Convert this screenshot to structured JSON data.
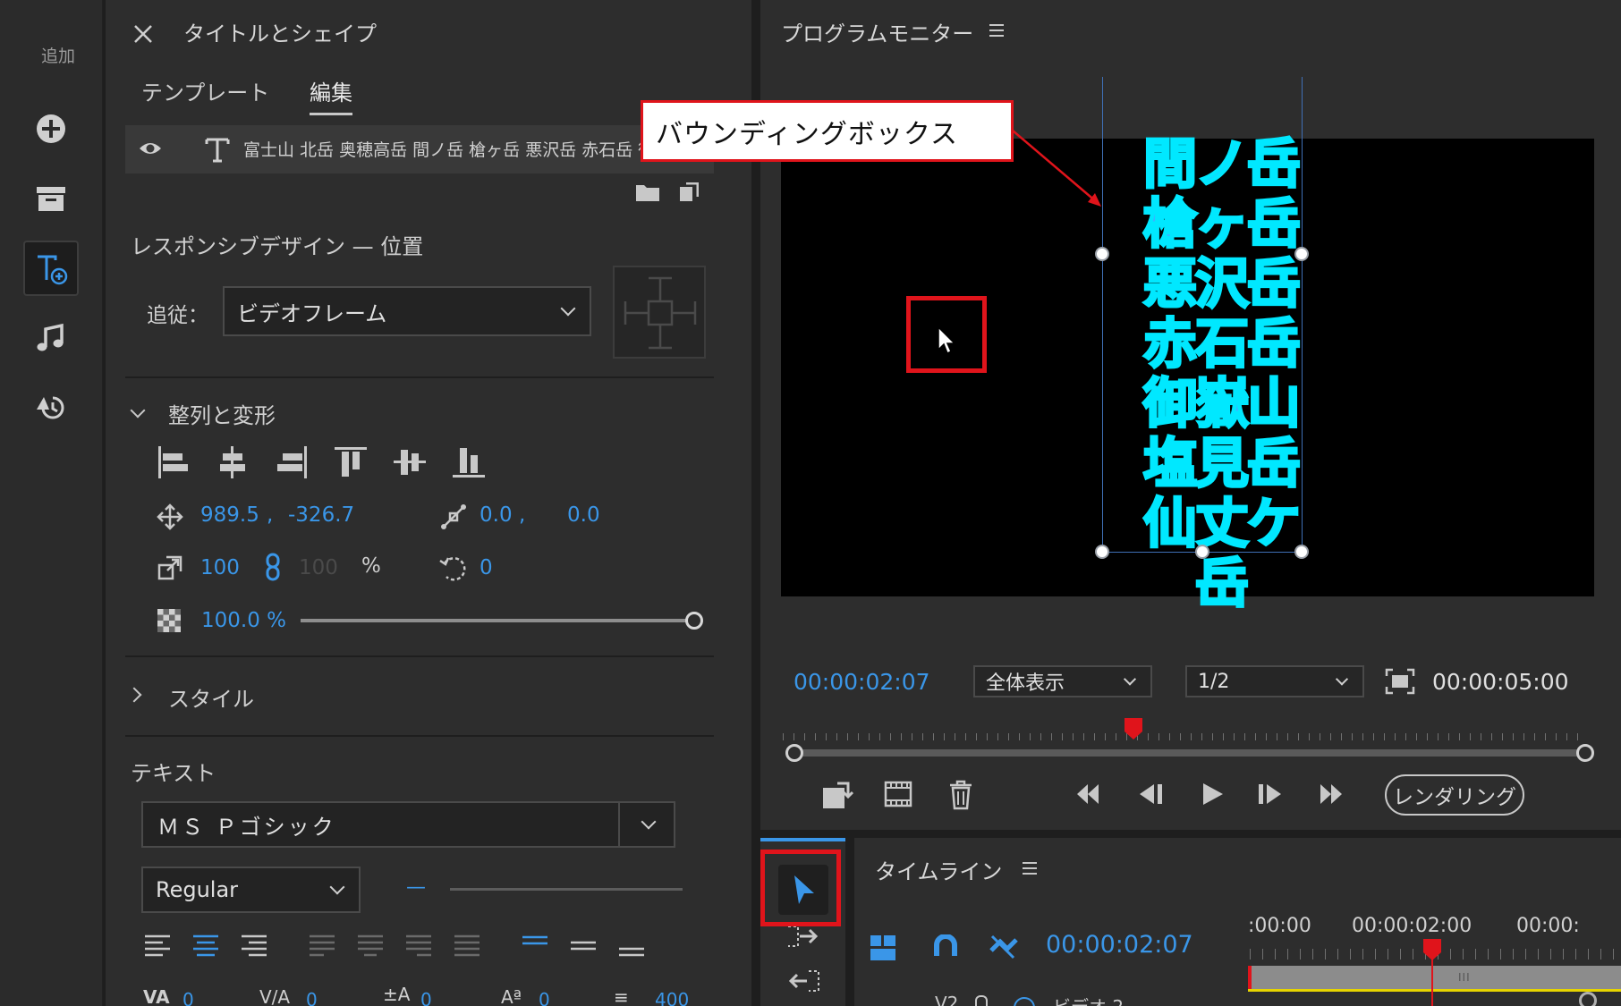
{
  "toolbar": {
    "add_label": "追加"
  },
  "essential_graphics": {
    "title": "タイトルとシェイプ",
    "tabs": [
      "テンプレート",
      "編集"
    ],
    "layer": {
      "name": "富士山 北岳 奥穂高岳 間ノ岳 槍ヶ岳 悪沢岳 赤石岳 御嶽"
    },
    "responsive": {
      "title": "レスポンシブデザイン — 位置",
      "follow_label": "追従：",
      "follow_value": "ビデオフレーム"
    },
    "align": {
      "title": "整列と変形",
      "position_x": "989.5",
      "position_y": "-326.7",
      "anchor_x": "0.0",
      "anchor_y": "0.0",
      "scale": "100",
      "scale_locked": "100",
      "scale_unit": "%",
      "rotation": "0",
      "opacity": "100.0 %",
      "opacity_level": 1.0
    },
    "style": {
      "title": "スタイル"
    },
    "text": {
      "title": "テキスト",
      "font": "ＭＳ Ｐゴシック",
      "font_style": "Regular",
      "size_placeholder": "—",
      "kerning": "0",
      "tracking": "0",
      "baseline": "0",
      "tsume": "0",
      "leading": "400"
    }
  },
  "program_monitor": {
    "title": "プログラムモニター",
    "text_lines": [
      "間ノ岳",
      "槍ヶ岳",
      "悪沢岳",
      "赤石岳",
      "御嶽山",
      "塩見岳",
      "仙丈ケ岳"
    ],
    "timecode": "00:00:02:07",
    "zoom": "全体表示",
    "resolution": "1/2",
    "duration": "00:00:05:00",
    "render_button": "レンダリング",
    "playhead_fraction": 0.44
  },
  "timeline": {
    "title": "タイムライン",
    "timecode": "00:00:02:07",
    "ruler_labels": [
      ":00:00",
      "00:00:02:00",
      "00:00:"
    ],
    "track_label": "V2",
    "track_name": "ビデオ 2"
  },
  "annotation": {
    "callout_text": "バウンディングボックス"
  },
  "colors": {
    "accent_blue": "#3a96e8",
    "annotation_red": "#e0141b",
    "title_text": "#37b6ff",
    "playhead_red": "#e0141b"
  }
}
